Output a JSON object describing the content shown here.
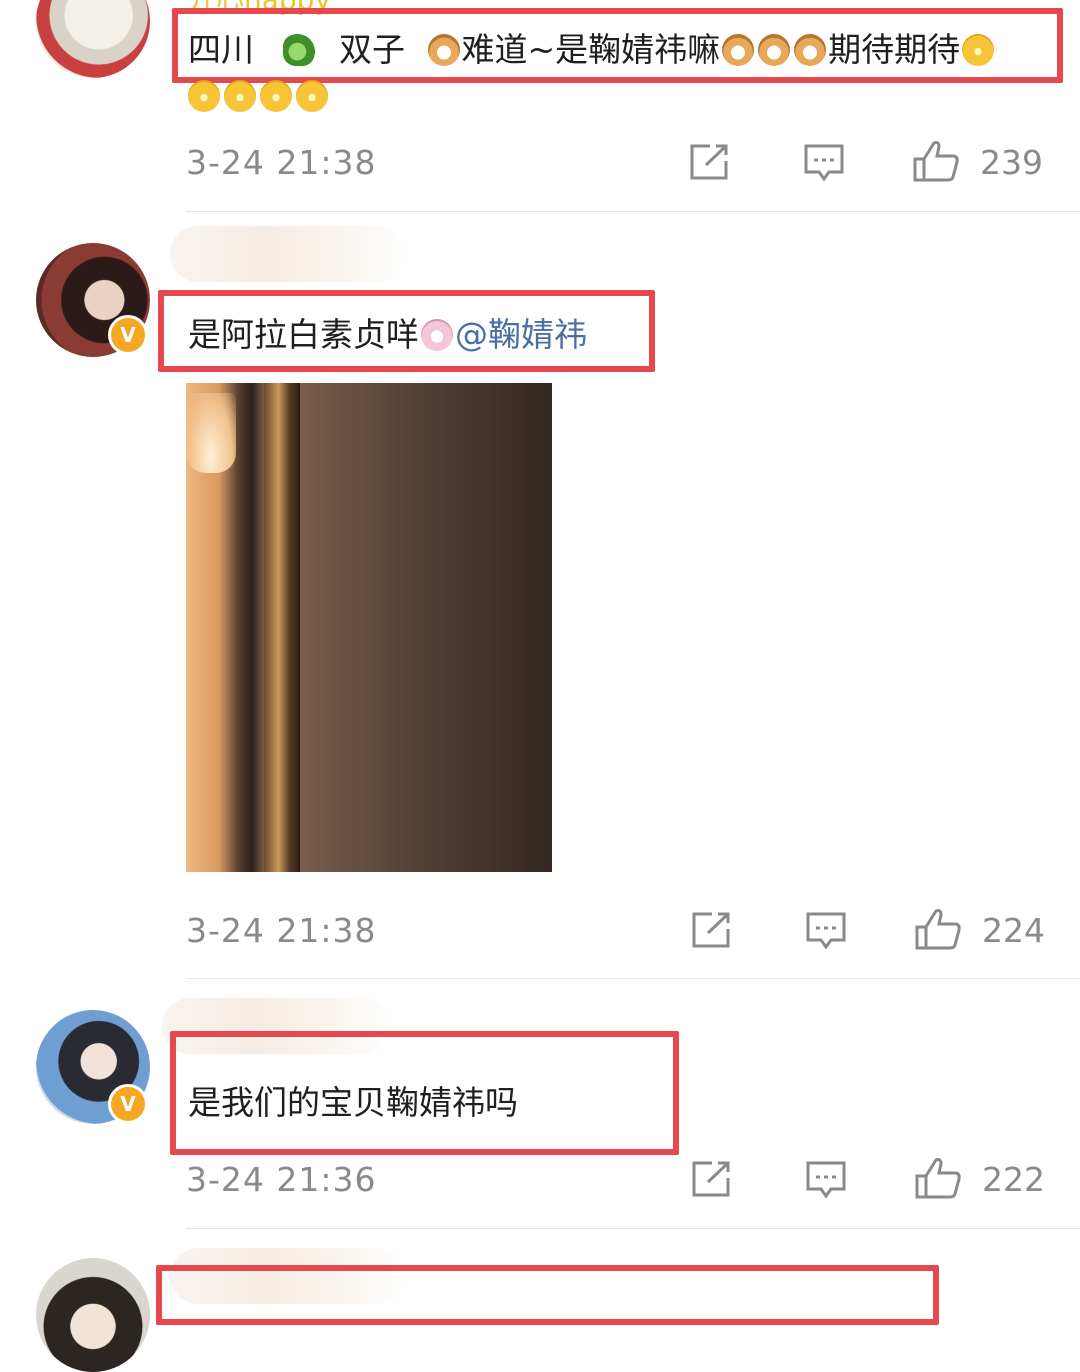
{
  "comments": [
    {
      "top_text_partial": "开心happy",
      "line1": {
        "location": "四川",
        "sign": "双子",
        "text_a": "难道~是鞠婧祎嘛",
        "text_b": "期待期待"
      },
      "timestamp": "3-24 21:38",
      "likes": "239"
    },
    {
      "text": "是阿拉白素贞咩",
      "mention": "@鞠婧祎",
      "verified": "V",
      "timestamp": "3-24 21:38",
      "likes": "224"
    },
    {
      "text": "是我们的宝贝鞠婧祎吗",
      "verified": "V",
      "timestamp": "3-24 21:36",
      "likes": "222"
    }
  ],
  "icons": {
    "share": "share-icon",
    "comment": "comment-icon",
    "like": "thumbs-up-icon",
    "verified": "verified-badge-icon"
  },
  "colors": {
    "highlight_box": "#e5484d",
    "mention": "#4a6fa5",
    "meta_text": "#8a8a8a",
    "verified_badge": "#f5a623"
  }
}
